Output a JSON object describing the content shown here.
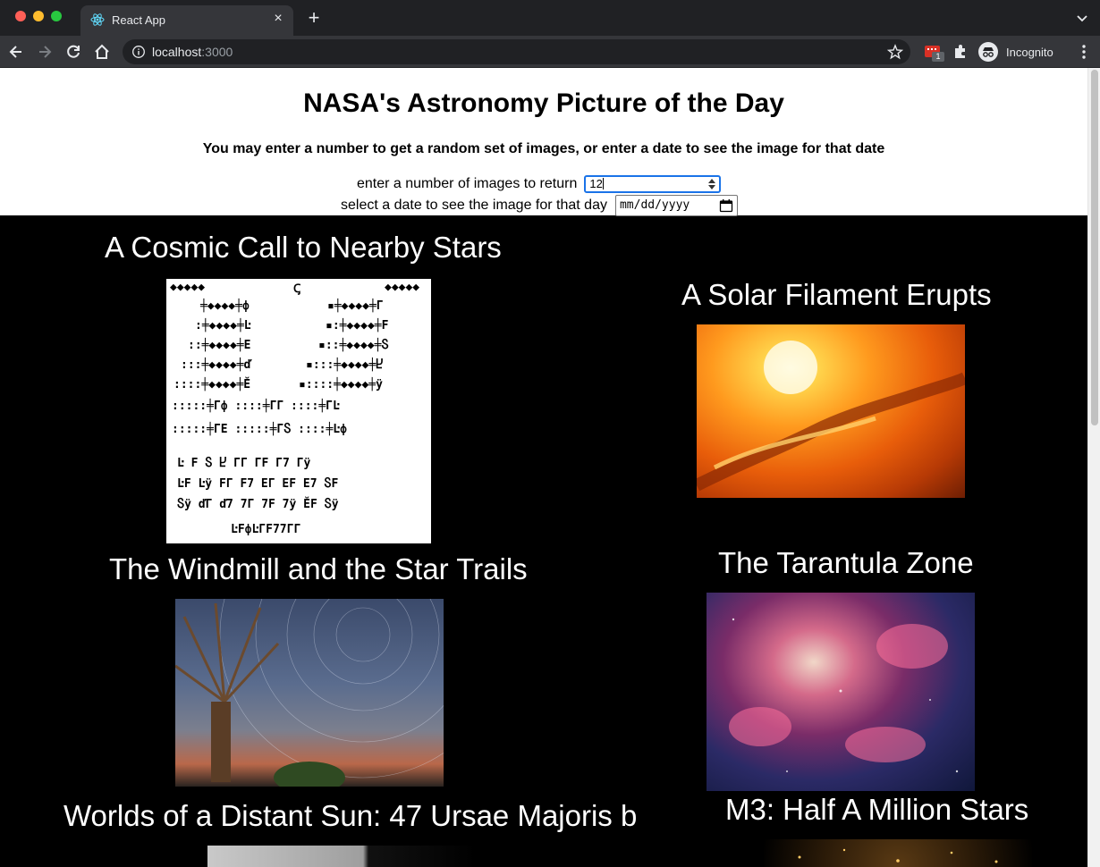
{
  "browser": {
    "tab_title": "React App",
    "url_host": "localhost",
    "url_port": ":3000",
    "extension_badge": "1",
    "incognito_label": "Incognito"
  },
  "header": {
    "title": "NASA's Astronomy Picture of the Day",
    "subtitle": "You may enter a number to get a random set of images, or enter a date to see the image for that date",
    "count_label": "enter a number of images to return",
    "count_value": "12",
    "date_label": "select a date to see the image for that day",
    "date_placeholder": "mm/dd/yyyy"
  },
  "images": [
    {
      "title": "A Cosmic Call to Nearby Stars"
    },
    {
      "title": "A Solar Filament Erupts"
    },
    {
      "title": "The Windmill and the Star Trails"
    },
    {
      "title": "The Tarantula Zone"
    },
    {
      "title": "Worlds of a Distant Sun: 47 Ursae Majoris b"
    },
    {
      "title": "M3: Half A Million Stars"
    }
  ],
  "colors": {
    "page_background": "#000000",
    "header_background": "#ffffff",
    "focus_ring": "#1a73e8"
  }
}
